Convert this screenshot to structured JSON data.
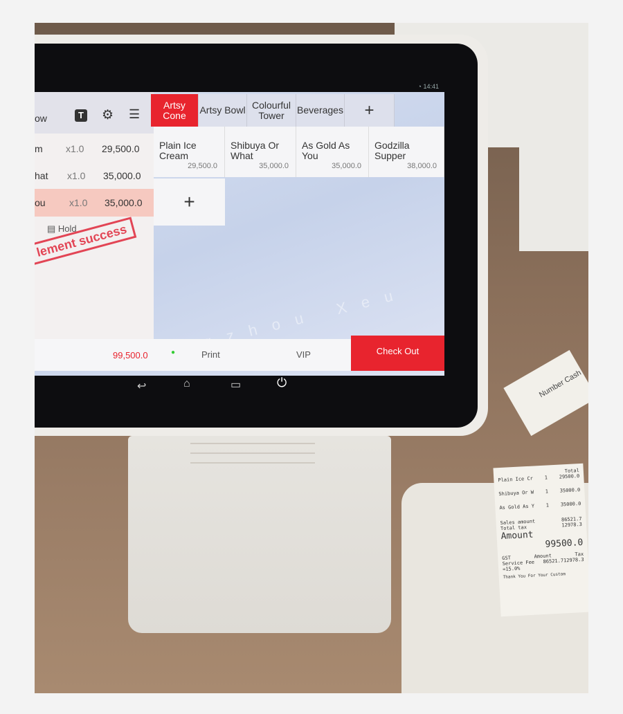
{
  "status_bar": {
    "time": "14:41",
    "wifi_icon": "wifi-icon"
  },
  "left_panel": {
    "header_text": "ow",
    "rows": [
      {
        "name": "m",
        "qty": "x1.0",
        "price": "29,500.0"
      },
      {
        "name": "hat",
        "qty": "x1.0",
        "price": "35,000.0"
      },
      {
        "name": "ou",
        "qty": "x1.0",
        "price": "35,000.0"
      }
    ],
    "hold_label": "Hold",
    "stamp_text": "lement success",
    "total": "99,500.0"
  },
  "tabs": [
    {
      "label": "Artsy Cone",
      "active": true
    },
    {
      "label": "Artsy Bowl"
    },
    {
      "label": "Colourful Tower"
    },
    {
      "label": "Beverages"
    },
    {
      "label": "+"
    }
  ],
  "products": [
    {
      "name": "Plain Ice Cream",
      "price": "29,500.0"
    },
    {
      "name": "Shibuya Or What",
      "price": "35,000.0"
    },
    {
      "name": "As Gold As You",
      "price": "35,000.0"
    },
    {
      "name": "Godzilla Supper",
      "price": "38,000.0"
    }
  ],
  "add_product": "+",
  "bottom_bar": {
    "print": "Print",
    "vip": "VIP",
    "checkout": "Check Out"
  },
  "watermark": "Guangzhou Xeu",
  "colors": {
    "accent": "#e8242e",
    "selected_row": "#f6c9c0"
  },
  "receipt": {
    "header": "Total",
    "lines": [
      {
        "item": "Plain Ice Cr",
        "qty": "1",
        "total": "29500.0"
      },
      {
        "item": "Shibuya Or W",
        "qty": "1",
        "total": "35000.0"
      },
      {
        "item": "As Gold As Y",
        "qty": "1",
        "total": "35000.0"
      }
    ],
    "sales_amount_label": "Sales amount",
    "sales_amount": "86521.7",
    "total_tax_label": "Total tax",
    "total_tax": "12978.3",
    "amount_label": "Amount",
    "amount": "99500.0",
    "gst_label": "GST",
    "amount_col": "Amount",
    "tax_col": "Tax",
    "service_fee": "Service Fee =15.0%",
    "service_amount": "86521.7",
    "service_tax": "12978.3",
    "thanks": "Thank You For Your Custom",
    "card_text": "Number Cash"
  }
}
